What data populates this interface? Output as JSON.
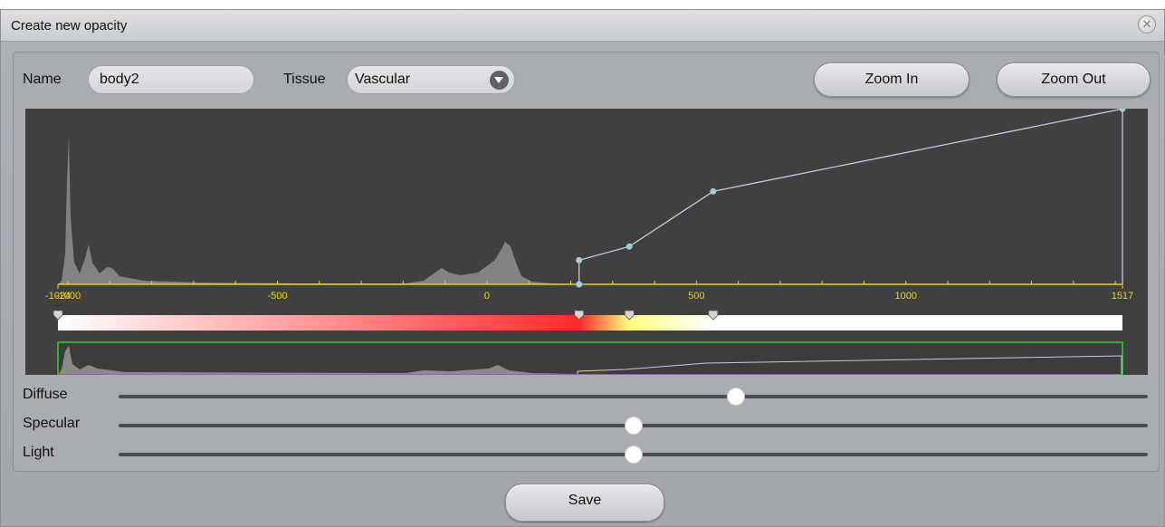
{
  "window": {
    "title": "Create new opacity"
  },
  "form": {
    "name_label": "Name",
    "name_value": "body2",
    "tissue_label": "Tissue",
    "tissue_value": "Vascular",
    "zoom_in_label": "Zoom In",
    "zoom_out_label": "Zoom Out"
  },
  "chart_data": {
    "type": "area",
    "x_range": [
      -1024,
      1517
    ],
    "tick_labels": [
      "-1000",
      "-1024",
      "-500",
      "0",
      "500",
      "1000",
      "1517"
    ],
    "opacity_points": [
      {
        "x": 220,
        "y": 0.0
      },
      {
        "x": 220,
        "y": 0.07
      },
      {
        "x": 340,
        "y": 0.11
      },
      {
        "x": 540,
        "y": 0.27
      },
      {
        "x": 1517,
        "y": 0.51
      },
      {
        "x": 1517,
        "y": 0.0
      }
    ],
    "color_stops": [
      {
        "x": -1024,
        "color": "#ffffff"
      },
      {
        "x": 220,
        "color": "#ff2a2a"
      },
      {
        "x": 340,
        "color": "#ffff80"
      },
      {
        "x": 540,
        "color": "#ffffff"
      },
      {
        "x": 1517,
        "color": "#ffffff"
      }
    ]
  },
  "sliders": [
    {
      "label": "Diffuse",
      "value": 0.6
    },
    {
      "label": "Specular",
      "value": 0.5
    },
    {
      "label": "Light",
      "value": 0.5
    }
  ],
  "footer": {
    "save_label": "Save"
  }
}
